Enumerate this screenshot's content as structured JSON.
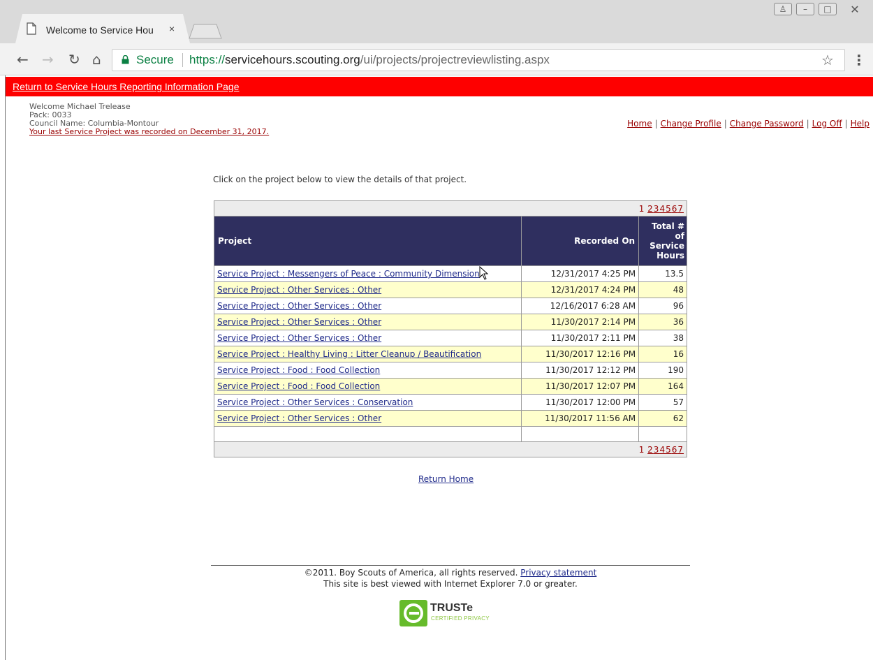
{
  "browser": {
    "tab_title": "Welcome to Service Hou",
    "tab_close": "×",
    "secure_label": "Secure",
    "url": {
      "scheme": "https://",
      "host": "servicehours.scouting.org",
      "path": "/ui/projects/projectreviewlisting.aspx"
    },
    "icons": [
      "back-icon",
      "forward-icon",
      "reload-icon",
      "home-icon",
      "lock-icon",
      "star-icon",
      "menu-icon"
    ]
  },
  "redbar": {
    "link_text": "Return to Service Hours Reporting Information Page"
  },
  "user": {
    "welcome": "Welcome Michael Trelease",
    "pack": "Pack: 0033",
    "council": "Council Name: Columbia-Montour",
    "last_recorded": "Your last Service Project was recorded on December 31, 2017."
  },
  "toplinks": {
    "home": "Home",
    "change_profile": "Change Profile",
    "change_password": "Change Password",
    "log_off": "Log Off",
    "help": "Help",
    "separator": "|"
  },
  "intro": "Click on the project below to view the details of that project.",
  "pager": {
    "current": "1",
    "pages": [
      "2",
      "3",
      "4",
      "5",
      "6",
      "7"
    ]
  },
  "table": {
    "headers": {
      "project": "Project",
      "recorded_on": "Recorded On",
      "hours_line1": "Total #",
      "hours_line2": "of",
      "hours_line3": "Service",
      "hours_line4": "Hours"
    },
    "rows": [
      {
        "project": "Service Project : Messengers of Peace : Community Dimension",
        "recorded": "12/31/2017 4:25 PM",
        "hours": "13.5"
      },
      {
        "project": "Service Project : Other Services : Other",
        "recorded": "12/31/2017 4:24 PM",
        "hours": "48"
      },
      {
        "project": "Service Project : Other Services : Other",
        "recorded": "12/16/2017 6:28 AM",
        "hours": "96"
      },
      {
        "project": "Service Project : Other Services : Other",
        "recorded": "11/30/2017 2:14 PM",
        "hours": "36"
      },
      {
        "project": "Service Project : Other Services : Other",
        "recorded": "11/30/2017 2:11 PM",
        "hours": "38"
      },
      {
        "project": "Service Project : Healthy Living : Litter Cleanup / Beautification",
        "recorded": "11/30/2017 12:16 PM",
        "hours": "16"
      },
      {
        "project": "Service Project : Food : Food Collection",
        "recorded": "11/30/2017 12:12 PM",
        "hours": "190"
      },
      {
        "project": "Service Project : Food : Food Collection",
        "recorded": "11/30/2017 12:07 PM",
        "hours": "164"
      },
      {
        "project": "Service Project : Other Services : Conservation",
        "recorded": "11/30/2017 12:00 PM",
        "hours": "57"
      },
      {
        "project": "Service Project : Other Services : Other",
        "recorded": "11/30/2017 11:56 AM",
        "hours": "62"
      }
    ]
  },
  "return_home": "Return Home",
  "footer": {
    "copyright": "©2011. Boy Scouts of America, all rights reserved.",
    "privacy": "Privacy statement",
    "browser_note": "This site is best viewed with Internet Explorer 7.0 or greater.",
    "truste_name": "TRUSTe",
    "truste_sub": "CERTIFIED PRIVACY"
  },
  "colors": {
    "red_bar": "#fe0000",
    "header_bg": "#2f2f5f",
    "alt_row": "#ffffcc",
    "link": "#1f2a8a",
    "dark_red_link": "#990000",
    "truste_green": "#66bb2b"
  }
}
